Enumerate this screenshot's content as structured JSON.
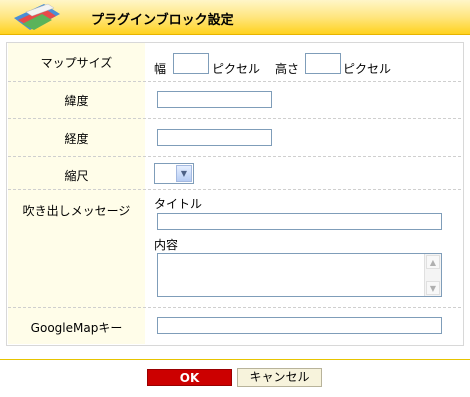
{
  "header": {
    "title": "プラグインブロック設定",
    "icon": "book-stack-icon"
  },
  "fields": {
    "map_size": {
      "label": "マップサイズ",
      "width_label": "幅",
      "height_label": "高さ",
      "unit": "ピクセル",
      "width_value": "",
      "height_value": ""
    },
    "latitude": {
      "label": "緯度",
      "value": ""
    },
    "longitude": {
      "label": "経度",
      "value": ""
    },
    "scale": {
      "label": "縮尺",
      "value": ""
    },
    "balloon": {
      "label": "吹き出しメッセージ",
      "title_label": "タイトル",
      "title_value": "",
      "content_label": "内容",
      "content_value": ""
    },
    "google_map_key": {
      "label": "GoogleMapキー",
      "value": ""
    }
  },
  "buttons": {
    "ok": "OK",
    "cancel": "キャンセル"
  },
  "colors": {
    "accent": "#ffd21f",
    "label_bg": "#fffde9",
    "ok_bg": "#cc0000"
  }
}
